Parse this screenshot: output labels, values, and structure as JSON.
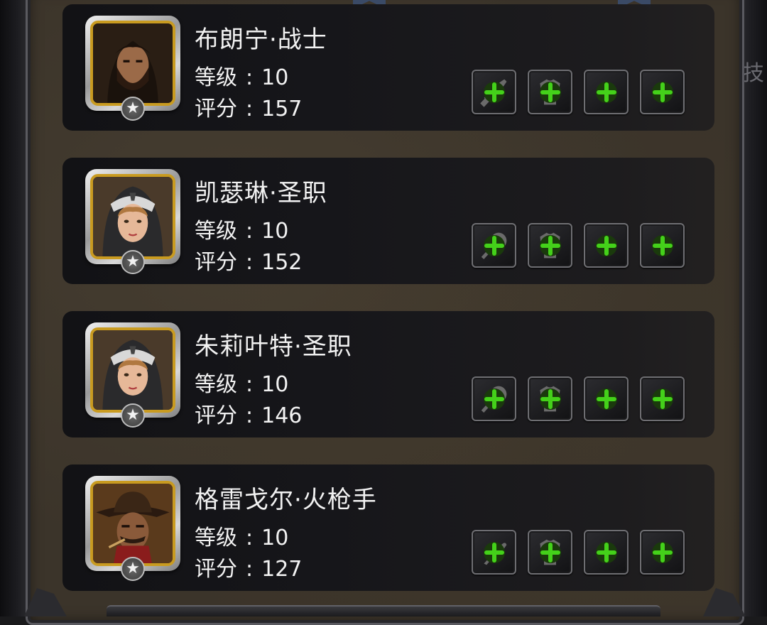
{
  "right_edge_text": "技",
  "accent": {
    "gold": "#c99b20",
    "plus_green": "#44d11a",
    "text": "#f2f2f2"
  },
  "heroes": [
    {
      "name": "布朗宁·战士",
      "level_label": "等级",
      "level_value": "10",
      "score_label": "评分",
      "score_value": "157",
      "portrait_icon": "bearded-warrior-portrait-icon",
      "slots": [
        "sword-slot-icon",
        "armor-slot-icon",
        "accessory-slot-icon",
        "accessory-slot-icon"
      ]
    },
    {
      "name": "凯瑟琳·圣职",
      "level_label": "等级",
      "level_value": "10",
      "score_label": "评分",
      "score_value": "152",
      "portrait_icon": "hooded-priestess-portrait-icon",
      "slots": [
        "mace-slot-icon",
        "armor-slot-icon",
        "accessory-slot-icon",
        "accessory-slot-icon"
      ]
    },
    {
      "name": "朱莉叶特·圣职",
      "level_label": "等级",
      "level_value": "10",
      "score_label": "评分",
      "score_value": "146",
      "portrait_icon": "hooded-priestess-portrait-icon",
      "slots": [
        "mace-slot-icon",
        "armor-slot-icon",
        "accessory-slot-icon",
        "accessory-slot-icon"
      ]
    },
    {
      "name": "格雷戈尔·火枪手",
      "level_label": "等级",
      "level_value": "10",
      "score_label": "评分",
      "score_value": "127",
      "portrait_icon": "musketeer-hat-portrait-icon",
      "slots": [
        "musket-slot-icon",
        "armor-slot-icon",
        "accessory-slot-icon",
        "accessory-slot-icon"
      ]
    }
  ]
}
